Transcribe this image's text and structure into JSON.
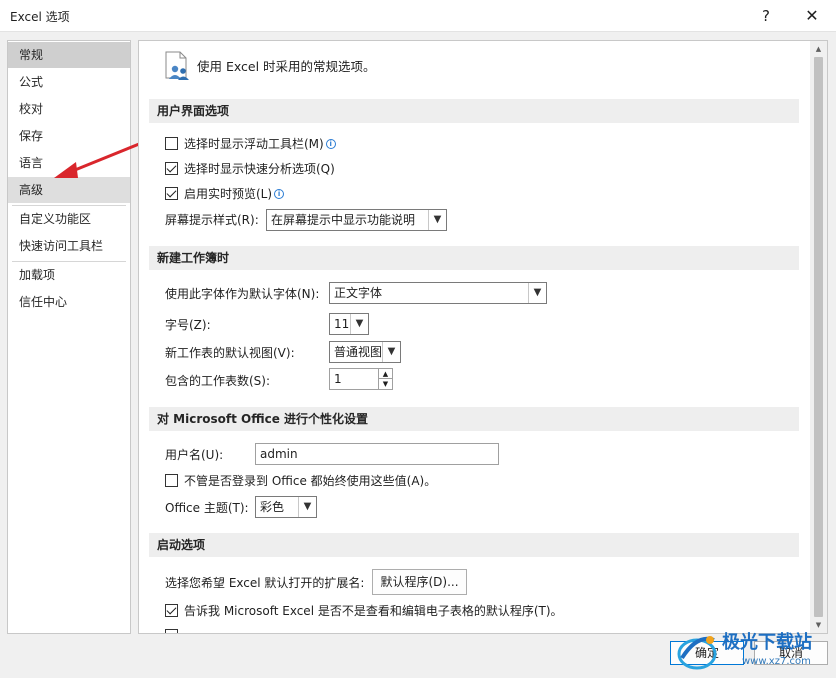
{
  "window": {
    "title": "Excel 选项",
    "help_glyph": "?",
    "close_glyph": "✕"
  },
  "nav": {
    "items": [
      {
        "label": "常规"
      },
      {
        "label": "公式"
      },
      {
        "label": "校对"
      },
      {
        "label": "保存"
      },
      {
        "label": "语言"
      },
      {
        "label": "高级"
      },
      {
        "label": "自定义功能区"
      },
      {
        "label": "快速访问工具栏"
      },
      {
        "label": "加载项"
      },
      {
        "label": "信任中心"
      }
    ]
  },
  "content": {
    "heading": "使用 Excel 时采用的常规选项。",
    "ui_section": {
      "title": "用户界面选项",
      "mini_toolbar": {
        "label": "选择时显示浮动工具栏(M)",
        "checked": false
      },
      "quick_analysis": {
        "label": "选择时显示快速分析选项(Q)",
        "checked": true
      },
      "live_preview": {
        "label": "启用实时预览(L)",
        "checked": true
      },
      "screentip_label": "屏幕提示样式(R):",
      "screentip_value": "在屏幕提示中显示功能说明"
    },
    "workbook_section": {
      "title": "新建工作簿时",
      "font_label": "使用此字体作为默认字体(N):",
      "font_value": "正文字体",
      "size_label": "字号(Z):",
      "size_value": "11",
      "view_label": "新工作表的默认视图(V):",
      "view_value": "普通视图",
      "sheets_label": "包含的工作表数(S):",
      "sheets_value": "1"
    },
    "personalize_section": {
      "title": "对 Microsoft Office 进行个性化设置",
      "username_label": "用户名(U):",
      "username_value": "admin",
      "always_use": {
        "label": "不管是否登录到 Office 都始终使用这些值(A)。",
        "checked": false
      },
      "theme_label": "Office 主题(T):",
      "theme_value": "彩色"
    },
    "startup_section": {
      "title": "启动选项",
      "ext_label": "选择您希望 Excel 默认打开的扩展名:",
      "default_programs_button": "默认程序(D)...",
      "tell_me": {
        "label": "告诉我 Microsoft Excel 是否不是查看和编辑电子表格的默认程序(T)。",
        "checked": true
      }
    }
  },
  "footer": {
    "ok_label": "确定",
    "cancel_label": "取消"
  },
  "watermark": {
    "line1": "极光下载站",
    "line2": "www.xz7.com"
  },
  "colors": {
    "arrow": "#d9262c",
    "accent": "#0078d7"
  }
}
